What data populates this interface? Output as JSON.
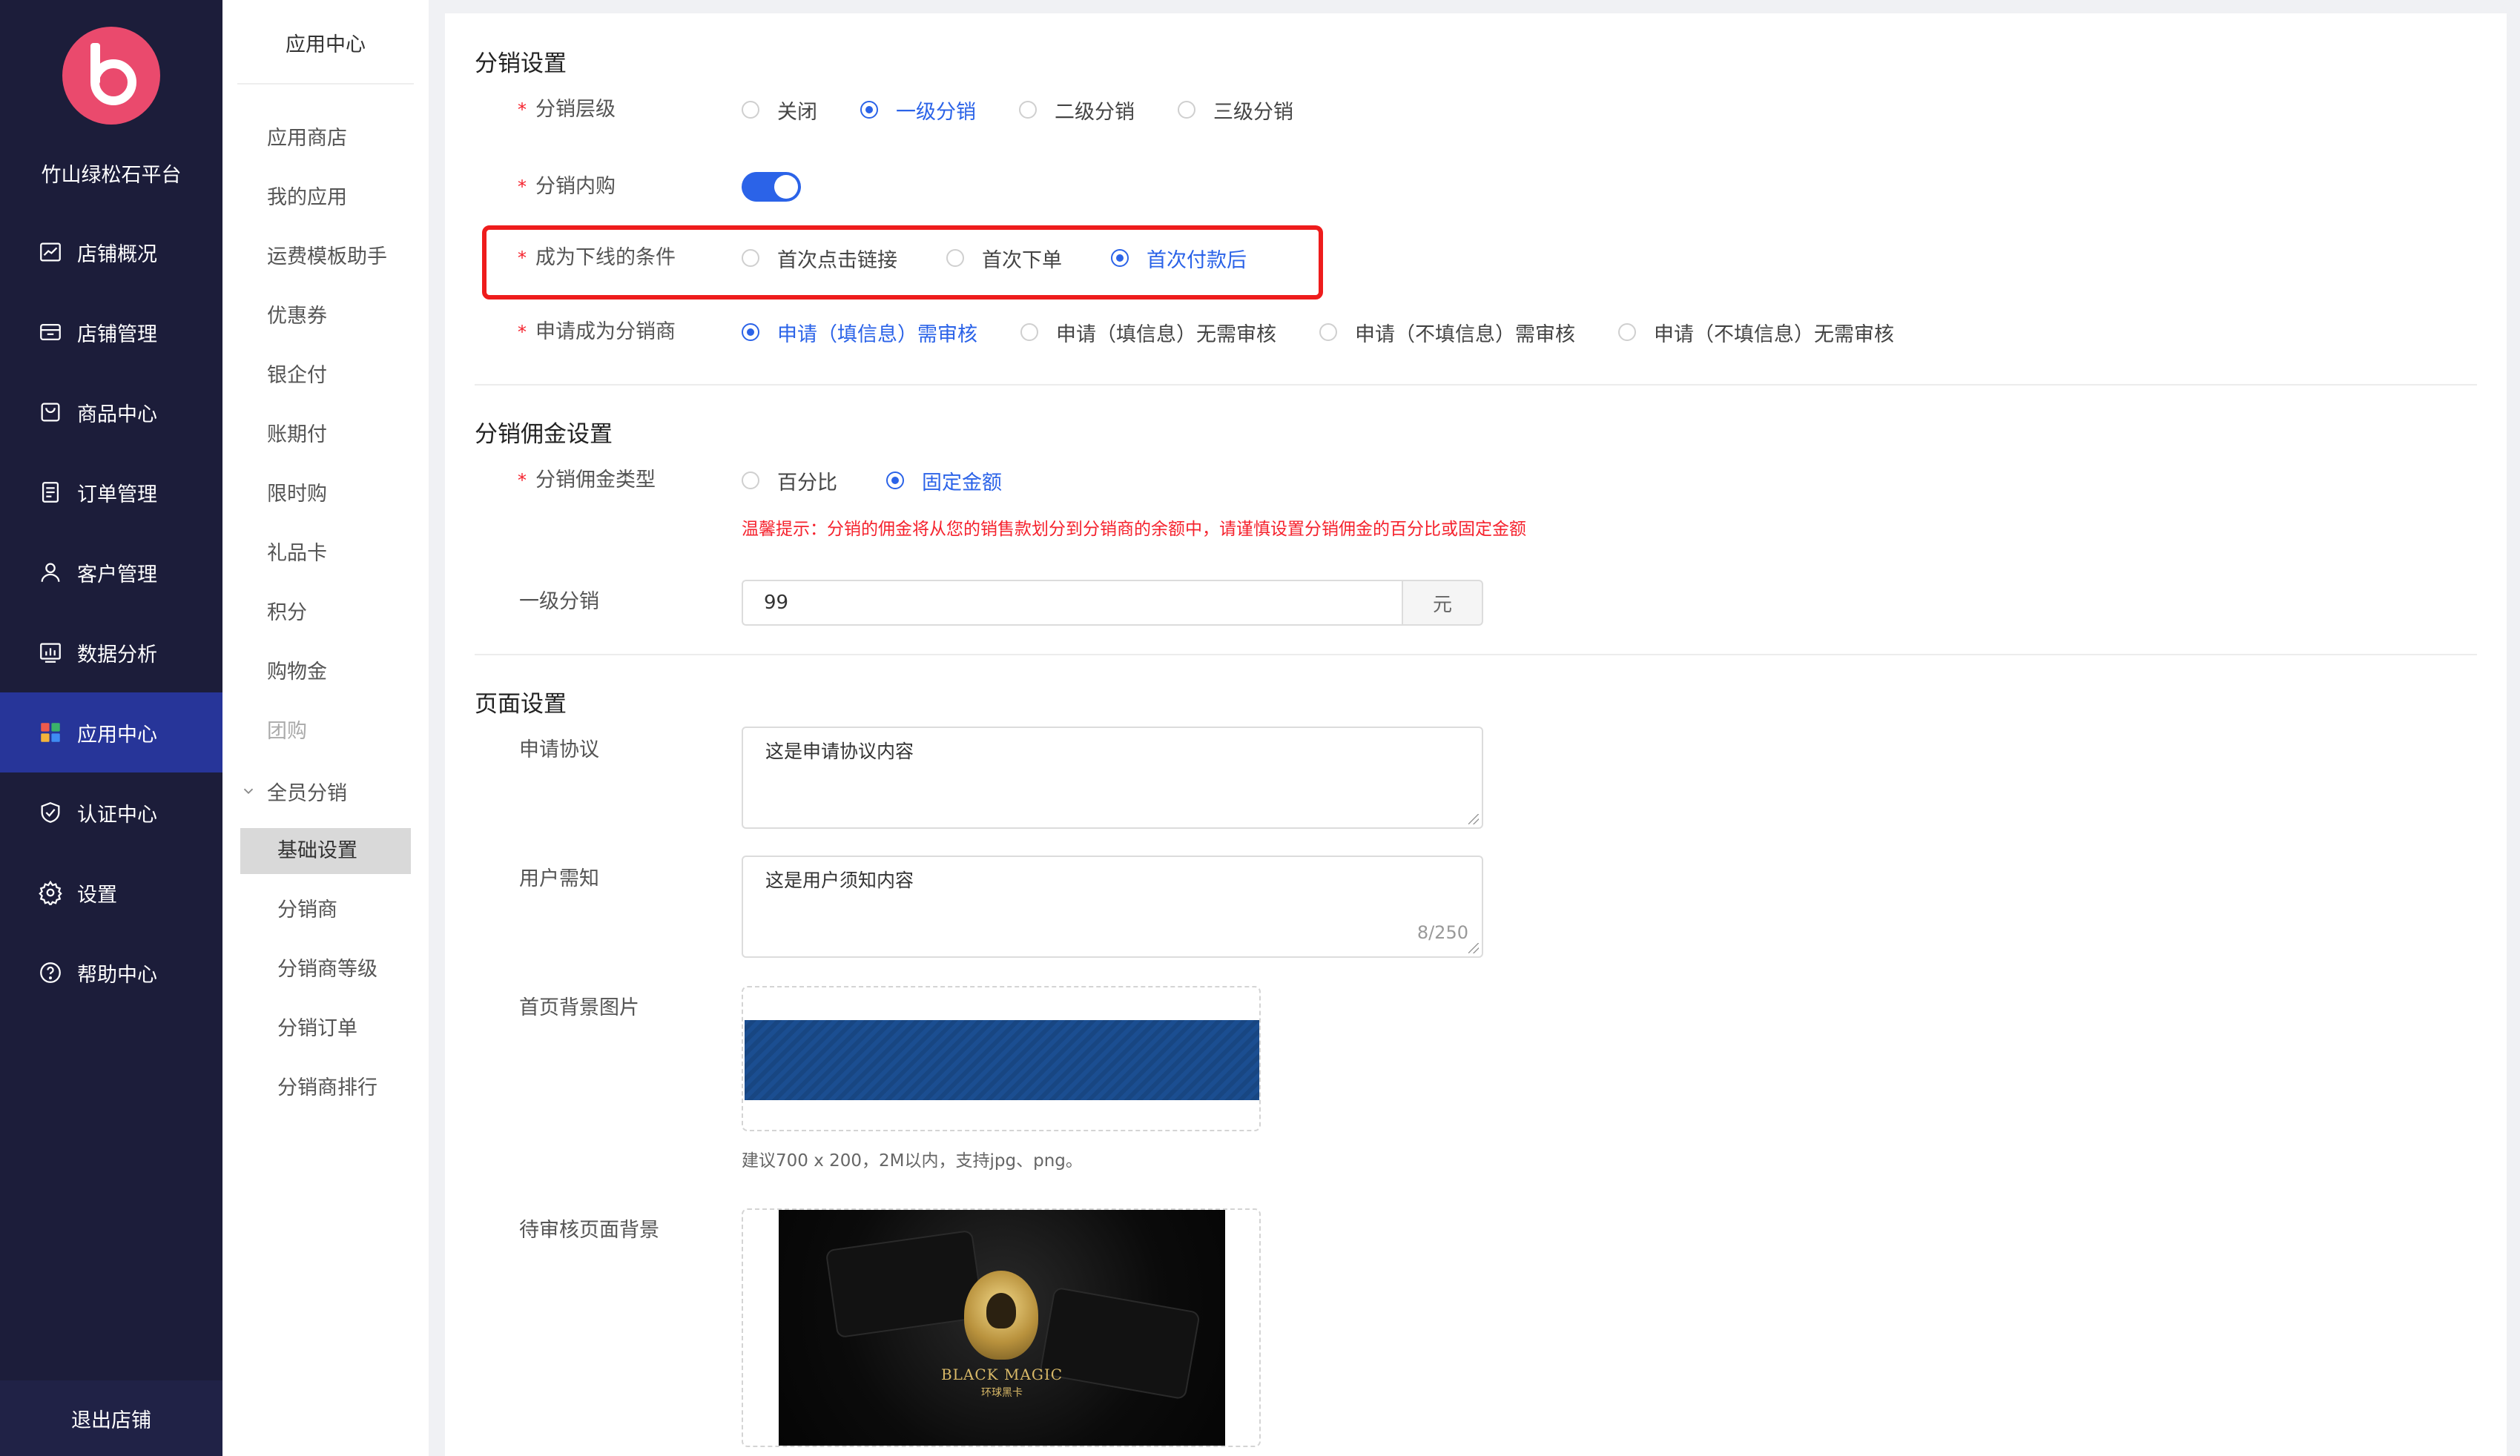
{
  "sidebar": {
    "platform_name": "竹山绿松石平台",
    "items": [
      {
        "label": "店铺概况",
        "icon": "chart-line-icon"
      },
      {
        "label": "店铺管理",
        "icon": "store-icon"
      },
      {
        "label": "商品中心",
        "icon": "shopping-bag-icon"
      },
      {
        "label": "订单管理",
        "icon": "order-list-icon"
      },
      {
        "label": "客户管理",
        "icon": "user-icon"
      },
      {
        "label": "数据分析",
        "icon": "bar-chart-icon"
      },
      {
        "label": "应用中心",
        "icon": "apps-grid-icon"
      },
      {
        "label": "认证中心",
        "icon": "shield-check-icon"
      },
      {
        "label": "设置",
        "icon": "gear-icon"
      },
      {
        "label": "帮助中心",
        "icon": "help-circle-icon"
      }
    ],
    "active_index": 6,
    "logout_label": "退出店铺"
  },
  "submenu": {
    "title": "应用中心",
    "items": [
      "应用商店",
      "我的应用",
      "运费模板助手",
      "优惠券",
      "银企付",
      "账期付",
      "限时购",
      "礼品卡",
      "积分",
      "购物金",
      "团购"
    ],
    "group_label": "全员分销",
    "group_children": [
      "基础设置",
      "分销商",
      "分销商等级",
      "分销订单",
      "分销商排行"
    ],
    "active_child": "基础设置"
  },
  "settings": {
    "section_title": "分销设置",
    "level": {
      "label": "分销层级",
      "options": [
        "关闭",
        "一级分销",
        "二级分销",
        "三级分销"
      ],
      "selected": "一级分销"
    },
    "internal_purchase": {
      "label": "分销内购",
      "enabled": true
    },
    "downline_condition": {
      "label": "成为下线的条件",
      "options": [
        "首次点击链接",
        "首次下单",
        "首次付款后"
      ],
      "selected": "首次付款后"
    },
    "apply": {
      "label": "申请成为分销商",
      "options": [
        "申请（填信息）需审核",
        "申请（填信息）无需审核",
        "申请（不填信息）需审核",
        "申请（不填信息）无需审核"
      ],
      "selected": "申请（填信息）需审核"
    }
  },
  "commission": {
    "section_title": "分销佣金设置",
    "type": {
      "label": "分销佣金类型",
      "options": [
        "百分比",
        "固定金额"
      ],
      "selected": "固定金额"
    },
    "warning": "温馨提示：分销的佣金将从您的销售款划分到分销商的余额中，请谨慎设置分销佣金的百分比或固定金额",
    "level1": {
      "label": "一级分销",
      "value": "99",
      "unit": "元"
    }
  },
  "page": {
    "section_title": "页面设置",
    "agreement": {
      "label": "申请协议",
      "value": "这是申请协议内容"
    },
    "notice": {
      "label": "用户需知",
      "value": "这是用户须知内容",
      "count": "8/250"
    },
    "home_bg": {
      "label": "首页背景图片",
      "hint": "建议700 x 200，2M以内，支持jpg、png。"
    },
    "review_bg": {
      "label": "待审核页面背景",
      "image_title": "BLACK MAGIC",
      "image_subtitle": "环球黑卡"
    }
  },
  "colors": {
    "sidebar_bg": "#1c1d3a",
    "sidebar_active": "#273599",
    "primary": "#2b63e8",
    "danger": "#ee1c1c",
    "logo": "#ea4a6d"
  }
}
